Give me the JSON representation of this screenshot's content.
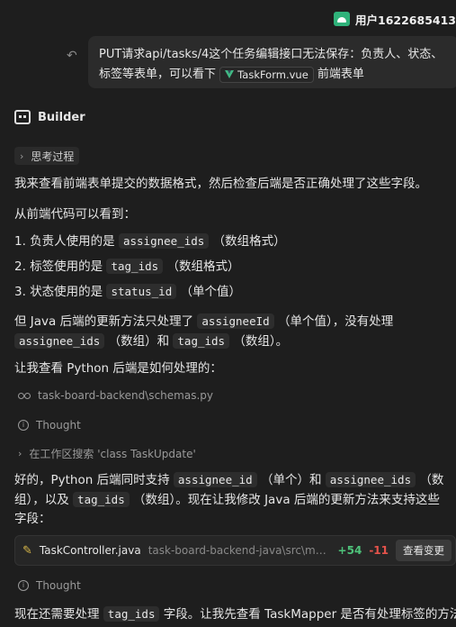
{
  "user": {
    "name": "用户1622685413"
  },
  "user_message": {
    "text_before": "PUT请求api/tasks/4这个任务编辑接口无法保存：负责人、状态、标签等表单，可以看下",
    "file_chip": "TaskForm.vue",
    "text_after": "前端表单"
  },
  "assistant": {
    "name": "Builder"
  },
  "thinking": {
    "label": "思考过程"
  },
  "messages": {
    "p1": "我来查看前端表单提交的数据格式，然后检查后端是否正确处理了这些字段。",
    "p2": "从前端代码可以看到：",
    "list": [
      {
        "num": "1.",
        "pre": "负责人使用的是",
        "code": "assignee_ids",
        "post": "（数组格式）"
      },
      {
        "num": "2.",
        "pre": "标签使用的是",
        "code": "tag_ids",
        "post": "（数组格式）"
      },
      {
        "num": "3.",
        "pre": "状态使用的是",
        "code": "status_id",
        "post": "（单个值）"
      }
    ],
    "p3_pre": "但 Java 后端的更新方法只处理了",
    "p3_code1": "assigneeId",
    "p3_mid": "（单个值），没有处理",
    "p3_code2": "assignee_ids",
    "p3_mid2": "（数组）和",
    "p3_code3": "tag_ids",
    "p3_post": "（数组）。",
    "p4": "让我查看 Python 后端是如何处理的：",
    "p5_pre": "好的，Python 后端同时支持",
    "p5_code1": "assignee_id",
    "p5_mid": "（单个）和",
    "p5_code2": "assignee_ids",
    "p5_mid2": "（数组），以及",
    "p5_code3": "tag_ids",
    "p5_post": "（数组）。现在让我修改 Java 后端的更新方法来支持这些字段：",
    "p6_pre": "现在还需要处理",
    "p6_code": "tag_ids",
    "p6_post": "字段。让我先查看 TaskMapper 是否有处理标签的方法："
  },
  "tools": {
    "view_file": "task-board-backend\\schemas.py",
    "thought1": "Thought",
    "search": "在工作区搜索 'class TaskUpdate'",
    "thought2": "Thought"
  },
  "edit_card": {
    "file": "TaskController.java",
    "path": "task-board-backend-java\\src\\main\\java\\c...",
    "additions": "+54",
    "deletions": "-11",
    "view_label": "查看变更"
  }
}
